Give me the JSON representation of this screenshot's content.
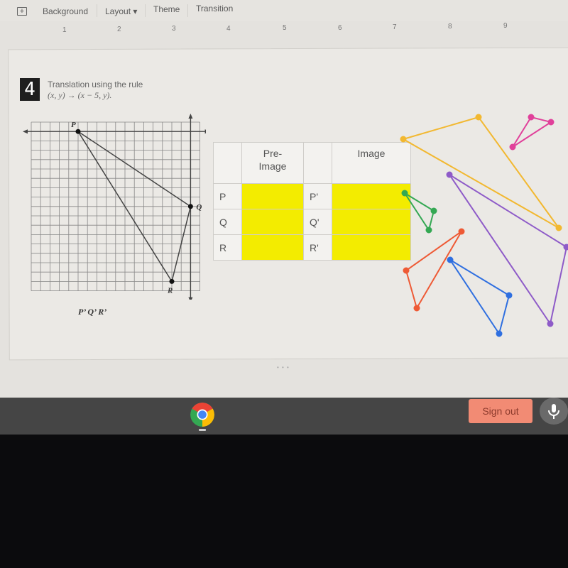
{
  "toolbar": {
    "add_icon": "add-comment-icon",
    "items": [
      "Background",
      "Layout ▾",
      "Theme",
      "Transition"
    ]
  },
  "ruler": {
    "numbers": [
      "1",
      "2",
      "3",
      "4",
      "5",
      "6",
      "7",
      "8",
      "9"
    ]
  },
  "question": {
    "number": "4",
    "title": "Translation using the rule",
    "rule": "(x, y) → (x − 5, y)."
  },
  "graph": {
    "grid_cols": 18,
    "grid_rows": 18,
    "points": [
      {
        "label": "P",
        "col": 5,
        "row": 1
      },
      {
        "label": "Q",
        "col": 17,
        "row": 9
      },
      {
        "label": "R",
        "col": 15,
        "row": 17
      }
    ]
  },
  "image_labels": "P’  Q’  R’",
  "table": {
    "header_preimage": "Pre-\nImage",
    "header_preimage_line1": "Pre-",
    "header_preimage_line2": "Image",
    "header_image": "Image",
    "rows": [
      {
        "pre_label": "P",
        "pre_value": "",
        "img_label": "P'",
        "img_value": ""
      },
      {
        "pre_label": "Q",
        "pre_value": "",
        "img_label": "Q'",
        "img_value": ""
      },
      {
        "pre_label": "R",
        "pre_value": "",
        "img_label": "R'",
        "img_value": ""
      }
    ],
    "fill_color": "#f3ec00"
  },
  "decor_triangles": [
    {
      "name": "yellow",
      "color": "#f2b830"
    },
    {
      "name": "pink",
      "color": "#e0409a"
    },
    {
      "name": "green",
      "color": "#34a853"
    },
    {
      "name": "purple",
      "color": "#8e5bc8"
    },
    {
      "name": "orange",
      "color": "#ee5a35"
    },
    {
      "name": "blue",
      "color": "#2f6fe0"
    }
  ],
  "shelf": {
    "app_icon": "chrome-icon",
    "sign_out_label": "Sign out",
    "mic_icon": "microphone-icon"
  }
}
